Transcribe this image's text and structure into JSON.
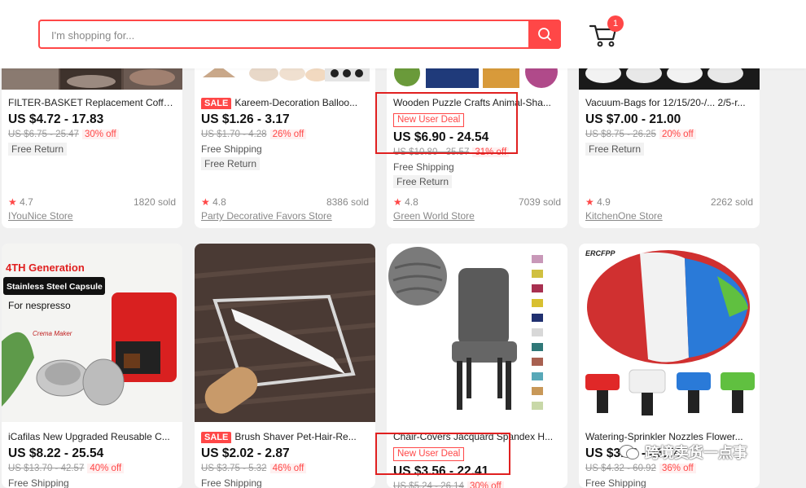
{
  "search": {
    "placeholder": "I'm shopping for..."
  },
  "cart": {
    "count": "1"
  },
  "watermark": {
    "text": "跨境卖货一点事"
  },
  "row1": [
    {
      "title": "FILTER-BASKET Replacement Coffe...",
      "sale": "",
      "new_user": "",
      "price": "US $4.72 - 17.83",
      "old_price": "US $6.75 - 25.47",
      "off": "30% off",
      "shipping": "",
      "free_return": "Free Return",
      "rating": "4.7",
      "sold": "1820 sold",
      "store": "IYouNice Store"
    },
    {
      "title": "Kareem-Decoration Balloo...",
      "sale": "SALE",
      "new_user": "",
      "price": "US $1.26 - 3.17",
      "old_price": "US $1.70 - 4.28",
      "off": "26% off",
      "shipping": "Free Shipping",
      "free_return": "Free Return",
      "rating": "4.8",
      "sold": "8386 sold",
      "store": "Party Decorative Favors Store"
    },
    {
      "title": "Wooden Puzzle Crafts Animal-Sha...",
      "sale": "",
      "new_user": "New User Deal",
      "price": "US $6.90 - 24.54",
      "old_price": "US $10.80 - 35.57",
      "off": "31% off",
      "shipping": "Free Shipping",
      "free_return": "Free Return",
      "rating": "4.8",
      "sold": "7039 sold",
      "store": "Green World Store"
    },
    {
      "title": "Vacuum-Bags for 12/15/20-/... 2/5-r...",
      "sale": "",
      "new_user": "",
      "price": "US $7.00 - 21.00",
      "old_price": "US $8.75 - 26.25",
      "off": "20% off",
      "shipping": "",
      "free_return": "Free Return",
      "rating": "4.9",
      "sold": "2262 sold",
      "store": "KitchenOne Store"
    }
  ],
  "row2": [
    {
      "title": "iCafilas New Upgraded Reusable C...",
      "sale": "",
      "new_user": "",
      "price": "US $8.22 - 25.54",
      "old_price": "US $13.70 - 42.57",
      "off": "40% off",
      "shipping": "Free Shipping"
    },
    {
      "title": "Brush Shaver Pet-Hair-Re...",
      "sale": "SALE",
      "new_user": "",
      "price": "US $2.02 - 2.87",
      "old_price": "US $3.75 - 5.32",
      "off": "46% off",
      "shipping": "Free Shipping"
    },
    {
      "title": "Chair-Covers Jacquard Spandex H...",
      "sale": "",
      "new_user": "New User Deal",
      "price": "US $3.56 - 22.41",
      "old_price": "US $5.24 - 26.14",
      "off": "30% off",
      "shipping": ""
    },
    {
      "title": "Watering-Sprinkler Nozzles Flower...",
      "sale": "",
      "new_user": "",
      "price": "US $3.46 - 46.74",
      "old_price": "US $4.32 - 60.92",
      "off": "36% off",
      "shipping": "Free Shipping"
    }
  ],
  "promo": {
    "generation": "4TH Generation",
    "capsule": "Stainless Steel Capsule",
    "for_brand": "For nespresso",
    "crema": "Crema Maker",
    "sprinkler_brand": "ERCFPP"
  },
  "colors": {
    "accent": "#ff4747",
    "annotation": "#e02020"
  }
}
